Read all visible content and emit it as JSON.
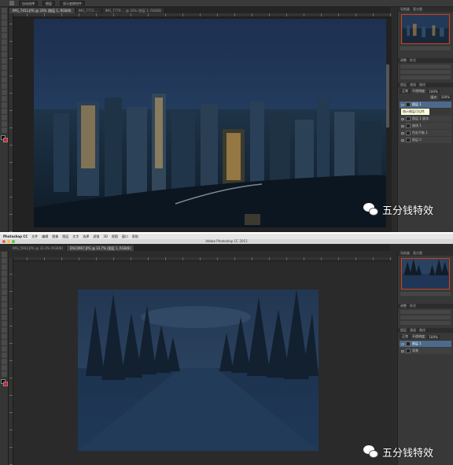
{
  "watermark": {
    "text": "五分钱特效"
  },
  "shot1": {
    "tabs": [
      "IMG_7452.JPG @ 33% (图层 1, RGB/8)",
      "IMG_7773 ...",
      "IMG_7779 ... @ 33% (图层 1, RGB/8)"
    ],
    "options": [
      "自动选择",
      "图层",
      "显示变换控件"
    ],
    "panel_tabs": [
      "导航器",
      "直方图"
    ],
    "panel_tabs2": [
      "调整",
      "样式"
    ],
    "layers_tabs": [
      "图层",
      "通道",
      "路径"
    ],
    "blend_mode": "正常",
    "opacity_label": "不透明度:",
    "opacity_value": "100%",
    "fill_label": "填充:",
    "fill_value": "100%",
    "layers": [
      "图层 1",
      "图层 1 副本",
      "曲线 1",
      "色彩平衡 1",
      "图层 0"
    ],
    "tooltip": "指示图层可见性"
  },
  "shot2": {
    "menubar": [
      "Photoshop CC",
      "文件",
      "编辑",
      "图像",
      "图层",
      "文字",
      "选择",
      "滤镜",
      "3D",
      "视图",
      "窗口",
      "帮助"
    ],
    "window_title": "Adobe Photoshop CC 2015",
    "tabs": [
      "IMG_5943.JPG @ 33.3% (RGB/8)",
      "DSC0967.JPG @ 33.7% (图层 1, RGB/8)"
    ],
    "panel_tabs": [
      "导航器",
      "直方图"
    ],
    "panel_tabs2": [
      "调整",
      "样式"
    ],
    "layers_tabs": [
      "图层",
      "通道",
      "路径"
    ],
    "blend_mode": "正常",
    "opacity_label": "不透明度:",
    "opacity_value": "100%",
    "layers": [
      "图层 1",
      "背景"
    ]
  }
}
